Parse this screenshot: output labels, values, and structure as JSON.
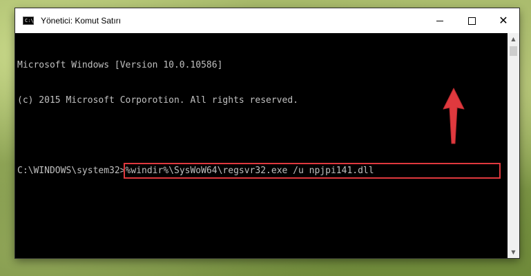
{
  "window": {
    "title": "Yönetici: Komut Satırı",
    "icon": "cmd-icon",
    "icon_text": "C:\\"
  },
  "controls": {
    "minimize_icon": "minimize-icon",
    "maximize_icon": "maximize-icon",
    "close_icon": "close-icon",
    "close_glyph": "✕"
  },
  "console": {
    "line1": "Microsoft Windows [Version 10.0.10586]",
    "line2": "(c) 2015 Microsoft Corporotion. All rights reserved.",
    "prompt": "C:\\WINDOWS\\system32>",
    "command": "%windir%\\SysWoW64\\regsvr32.exe /u npjpi141.dll"
  },
  "scrollbar": {
    "up_glyph": "▲",
    "down_glyph": "▼"
  },
  "annotation": {
    "highlight_color": "#e0393e",
    "arrow_icon": "red-arrow-icon"
  }
}
